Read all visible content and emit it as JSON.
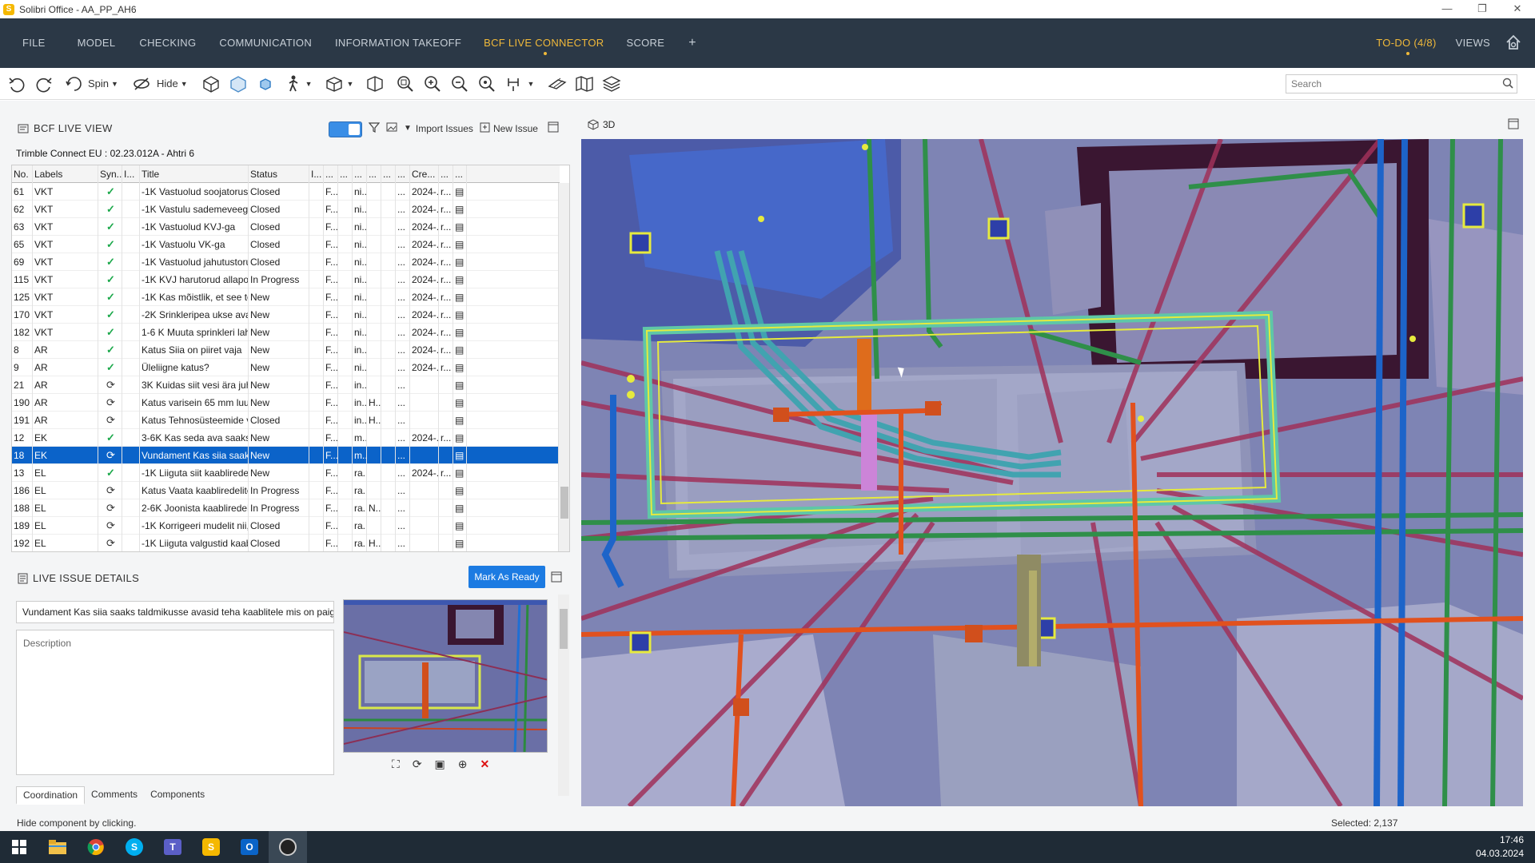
{
  "window": {
    "title": "Solibri Office - AA_PP_AH6",
    "controls": [
      "—",
      "❐",
      "✕"
    ]
  },
  "menu": {
    "items": [
      "FILE",
      "MODEL",
      "CHECKING",
      "COMMUNICATION",
      "INFORMATION TAKEOFF",
      "BCF LIVE CONNECTOR",
      "SCORE",
      "+"
    ],
    "active": "BCF LIVE CONNECTOR",
    "todo": "TO-DO (4/8)",
    "views": "VIEWS",
    "accent": "#f0b93a"
  },
  "toolbar": {
    "spin": "Spin",
    "hide": "Hide",
    "search_placeholder": "Search"
  },
  "bcf": {
    "title": "BCF LIVE VIEW",
    "import": "Import Issues",
    "new_issue": "New Issue",
    "project": "Trimble Connect EU : 02.23.012A - Ahtri 6",
    "columns": [
      "No.",
      "Labels",
      "Syn...",
      "I...",
      "Title",
      "Status",
      "I...",
      "...",
      "...",
      "...",
      "...",
      "...",
      "...",
      "Cre...",
      "...",
      "..."
    ],
    "rows": [
      {
        "no": "61",
        "label": "VKT",
        "sync": "check",
        "title": "-1K Vastuolud soojatorustiku...",
        "status": "Closed",
        "a": "F...",
        "b": "ni...",
        "c": "",
        "cre": "2024-...",
        "d": "r..."
      },
      {
        "no": "62",
        "label": "VKT",
        "sync": "check",
        "title": "-1K Vastulu sademeveega",
        "status": "Closed",
        "a": "F...",
        "b": "ni...",
        "c": "",
        "cre": "2024-...",
        "d": "r..."
      },
      {
        "no": "63",
        "label": "VKT",
        "sync": "check",
        "title": "-1K Vastuolud KVJ-ga",
        "status": "Closed",
        "a": "F...",
        "b": "ni...",
        "c": "",
        "cre": "2024-...",
        "d": "r..."
      },
      {
        "no": "65",
        "label": "VKT",
        "sync": "check",
        "title": "-1K Vastuolu VK-ga",
        "status": "Closed",
        "a": "F...",
        "b": "ni...",
        "c": "",
        "cre": "2024-...",
        "d": "r..."
      },
      {
        "no": "69",
        "label": "VKT",
        "sync": "check",
        "title": "-1K Vastuolud jahutustorusti...",
        "status": "Closed",
        "a": "F...",
        "b": "ni...",
        "c": "",
        "cre": "2024-...",
        "d": "r..."
      },
      {
        "no": "115",
        "label": "VKT",
        "sync": "check",
        "title": "-1K KVJ harutorud allapoole",
        "status": "In Progress",
        "a": "F...",
        "b": "ni...",
        "c": "",
        "cre": "2024-...",
        "d": "r..."
      },
      {
        "no": "125",
        "label": "VKT",
        "sync": "check",
        "title": "-1K Kas mõistlik, et see toru ...",
        "status": "New",
        "a": "F...",
        "b": "ni...",
        "c": "",
        "cre": "2024-...",
        "d": "r..."
      },
      {
        "no": "170",
        "label": "VKT",
        "sync": "check",
        "title": "-2K Srinkleripea ukse avanem...",
        "status": "New",
        "a": "F...",
        "b": "ni...",
        "c": "",
        "cre": "2024-...",
        "d": "r..."
      },
      {
        "no": "182",
        "label": "VKT",
        "sync": "check",
        "title": "1-6 K Muuta sprinkleri lahen...",
        "status": "New",
        "a": "F...",
        "b": "ni...",
        "c": "",
        "cre": "2024-...",
        "d": "r..."
      },
      {
        "no": "8",
        "label": "AR",
        "sync": "check",
        "title": "Katus Siia on piiret vaja",
        "status": "New",
        "a": "F...",
        "b": "in...",
        "c": "",
        "cre": "2024-...",
        "d": "r..."
      },
      {
        "no": "9",
        "label": "AR",
        "sync": "check",
        "title": "Üleliigne katus?",
        "status": "New",
        "a": "F...",
        "b": "ni...",
        "c": "",
        "cre": "2024-...",
        "d": "r..."
      },
      {
        "no": "21",
        "label": "AR",
        "sync": "sync",
        "title": "3K Kuidas siit vesi ära juhitak...",
        "status": "New",
        "a": "F...",
        "b": "in...",
        "c": "",
        "cre": "",
        "d": ""
      },
      {
        "no": "190",
        "label": "AR",
        "sync": "sync",
        "title": "Katus varisein 65 mm luugi p...",
        "status": "New",
        "a": "F...",
        "b": "in...",
        "c": "H...",
        "cre": "",
        "d": ""
      },
      {
        "no": "191",
        "label": "AR",
        "sync": "sync",
        "title": "Katus Tehnosüsteemide varis...",
        "status": "Closed",
        "a": "F...",
        "b": "in...",
        "c": "H...",
        "cre": "",
        "d": ""
      },
      {
        "no": "12",
        "label": "EK",
        "sync": "check",
        "title": "3-6K Kas seda ava saaks teha ...",
        "status": "New",
        "a": "F...",
        "b": "m...",
        "c": "",
        "cre": "2024-...",
        "d": "r..."
      },
      {
        "no": "18",
        "label": "EK",
        "sync": "sync",
        "title": "Vundament Kas siia saaks tal...",
        "status": "New",
        "a": "F...",
        "b": "m...",
        "c": "",
        "cre": "",
        "d": "",
        "selected": true
      },
      {
        "no": "13",
        "label": "EL",
        "sync": "check",
        "title": "-1K Liiguta siit kaabliredelit n...",
        "status": "New",
        "a": "F...",
        "b": "ra...",
        "c": "",
        "cre": "2024-...",
        "d": "r..."
      },
      {
        "no": "186",
        "label": "EL",
        "sync": "sync",
        "title": "Katus Vaata kaabliredelite pai...",
        "status": "In Progress",
        "a": "F...",
        "b": "ra...",
        "c": "",
        "cre": "",
        "d": ""
      },
      {
        "no": "188",
        "label": "EL",
        "sync": "sync",
        "title": "2-6K Joonista kaabliredelid ni...",
        "status": "In Progress",
        "a": "F...",
        "b": "ra...",
        "c": "N...",
        "cre": "",
        "d": ""
      },
      {
        "no": "189",
        "label": "EL",
        "sync": "sync",
        "title": "-1K Korrigeeri mudelit nii, et l...",
        "status": "Closed",
        "a": "F...",
        "b": "ra...",
        "c": "",
        "cre": "",
        "d": ""
      },
      {
        "no": "192",
        "label": "EL",
        "sync": "sync",
        "title": "-1K Liiguta valgustid kaablire...",
        "status": "Closed",
        "a": "F...",
        "b": "ra...",
        "c": "H...",
        "cre": "",
        "d": ""
      }
    ]
  },
  "details": {
    "title": "LIVE ISSUE DETAILS",
    "mark_ready": "Mark As Ready",
    "issue_title": "Vundament Kas siia saaks taldmikusse avasid teha kaablitele mis on paig",
    "description_placeholder": "Description",
    "tabs": [
      "Coordination",
      "Comments",
      "Components"
    ]
  },
  "viewer": {
    "label": "3D"
  },
  "status": {
    "hint": "Hide component by clicking.",
    "selected": "Selected: 2,137"
  },
  "clock": {
    "time": "17:46",
    "date": "04.03.2024"
  }
}
